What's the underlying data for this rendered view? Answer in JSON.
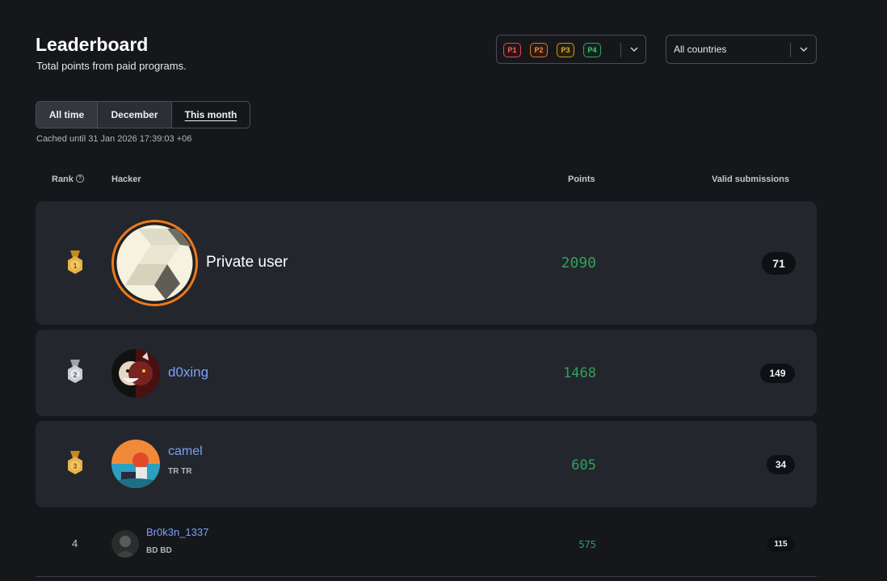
{
  "header": {
    "title": "Leaderboard",
    "subtitle": "Total points from paid programs."
  },
  "filters": {
    "priorities": [
      "P1",
      "P2",
      "P3",
      "P4"
    ],
    "country": "All countries"
  },
  "tabs": [
    {
      "label": "All time",
      "state": "default"
    },
    {
      "label": "December",
      "state": "default"
    },
    {
      "label": "This month",
      "state": "selected"
    }
  ],
  "cached_note": "Cached until 31 Jan 2026 17:39:03 +06",
  "columns": {
    "rank": "Rank",
    "hacker": "Hacker",
    "points": "Points",
    "valid": "Valid submissions"
  },
  "rows": [
    {
      "rank": "1",
      "name": "Private user",
      "country": "",
      "points": "2090",
      "valid": "71"
    },
    {
      "rank": "2",
      "name": "d0xing",
      "country": "",
      "points": "1468",
      "valid": "149"
    },
    {
      "rank": "3",
      "name": "camel",
      "country": "TR TR",
      "points": "605",
      "valid": "34"
    },
    {
      "rank": "4",
      "name": "Br0k3n_1337",
      "country": "BD BD",
      "points": "575",
      "valid": "115"
    }
  ],
  "colors": {
    "background": "#15171b",
    "card": "#23262c",
    "points": "#2fa15c",
    "link": "#7aa2f7",
    "gold": "#e0a83a",
    "silver": "#c9ccd2",
    "bronze": "#e0a83a"
  }
}
